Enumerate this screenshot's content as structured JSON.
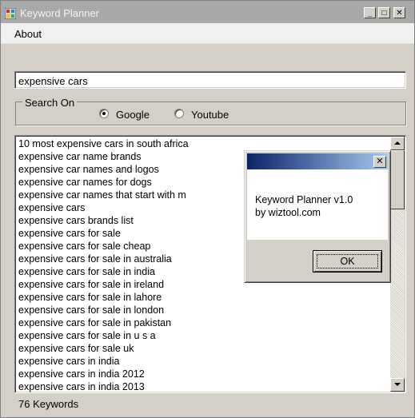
{
  "window": {
    "title": "Keyword Planner",
    "controls": {
      "minimize": "_",
      "maximize": "□",
      "close": "✕"
    }
  },
  "menu": {
    "about": "About"
  },
  "search": {
    "value": "expensive cars"
  },
  "search_on": {
    "legend": "Search On",
    "options": [
      {
        "label": "Google",
        "selected": true
      },
      {
        "label": "Youtube",
        "selected": false
      }
    ]
  },
  "results": [
    "10 most expensive cars in south africa",
    "expensive car name brands",
    "expensive car names and logos",
    "expensive car names for dogs",
    "expensive car names that start with m",
    "expensive cars",
    "expensive cars brands list",
    "expensive cars for sale",
    "expensive cars for sale cheap",
    "expensive cars for sale in australia",
    "expensive cars for sale in india",
    "expensive cars for sale in ireland",
    "expensive cars for sale in lahore",
    "expensive cars for sale in london",
    "expensive cars for sale in pakistan",
    "expensive cars for sale in u s a",
    "expensive cars for sale uk",
    "expensive cars in india",
    "expensive cars in india 2012",
    "expensive cars in india 2013"
  ],
  "status": {
    "keyword_count": "76 Keywords"
  },
  "about_dialog": {
    "line1": "Keyword Planner v1.0",
    "line2": "by wiztool.com",
    "ok_label": "OK",
    "close_glyph": "✕"
  },
  "colors": {
    "window_bg": "#d4d0c8",
    "titlebar_inactive": "#a9a9a9",
    "dialog_title_start": "#0a246a",
    "dialog_title_end": "#a6caf0"
  }
}
